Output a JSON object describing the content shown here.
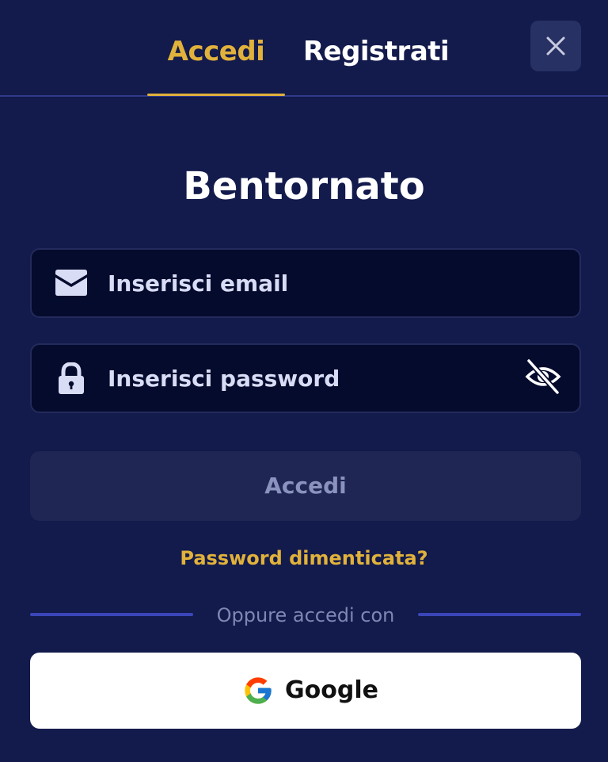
{
  "tabs": {
    "login_label": "Accedi",
    "register_label": "Registrati",
    "active": "login"
  },
  "title": "Bentornato",
  "email": {
    "placeholder": "Inserisci email",
    "value": "",
    "icon": "envelope-icon"
  },
  "password": {
    "placeholder": "Inserisci password",
    "value": "",
    "icon": "lock-icon",
    "toggle_icon": "eye-slash-icon"
  },
  "submit_label": "Accedi",
  "forgot_password_label": "Password dimenticata?",
  "divider_text": "Oppure accedi con",
  "google": {
    "label": "Google",
    "icon": "google-logo-icon"
  },
  "colors": {
    "background": "#131a4c",
    "accent": "#e1b23b",
    "field_background": "#050b2d",
    "disabled_button": "#1f2653",
    "divider": "#3a46b8"
  }
}
